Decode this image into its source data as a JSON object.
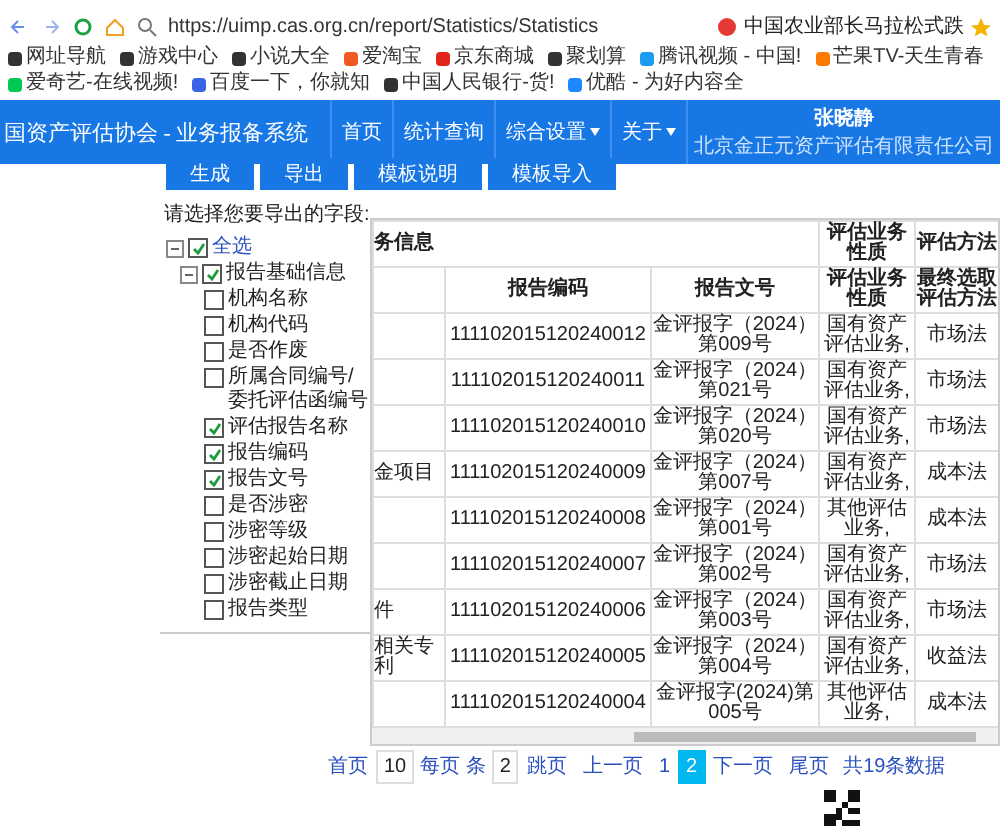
{
  "browser": {
    "url": "https://uimp.cas.org.cn/report/Statistics/Statistics",
    "search_text": "中国农业部长马拉松式跌",
    "bookmarks": [
      "网址导航",
      "游戏中心",
      "小说大全",
      "爱淘宝",
      "京东商城",
      "聚划算",
      "腾讯视频 - 中国!",
      "芒果TV-天生青春",
      "爱奇艺-在线视频!",
      "百度一下，你就知",
      "中国人民银行-货!",
      "优酷 - 为好内容全"
    ]
  },
  "header": {
    "title": "国资产评估协会 - 业务报备系统",
    "nav": [
      {
        "label": "首页",
        "dropdown": false
      },
      {
        "label": "统计查询",
        "dropdown": false
      },
      {
        "label": "综合设置",
        "dropdown": true
      },
      {
        "label": "关于",
        "dropdown": true
      }
    ],
    "user": {
      "name": "张晓静",
      "org": "北京金正元资产评估有限责任公司"
    }
  },
  "toolbar": [
    "生成",
    "导出",
    "模板说明",
    "模板导入"
  ],
  "field_picker": {
    "prompt": "请选择您要导出的字段:",
    "tree": [
      {
        "label": "全选",
        "checked": true,
        "expanded": true,
        "children": [
          {
            "label": "报告基础信息",
            "checked": true,
            "expanded": true,
            "children": [
              {
                "label": "机构名称",
                "checked": false
              },
              {
                "label": "机构代码",
                "checked": false
              },
              {
                "label": "是否作废",
                "checked": false
              },
              {
                "label": "所属合同编号/委托评估函编号",
                "checked": false
              },
              {
                "label": "评估报告名称",
                "checked": true
              },
              {
                "label": "报告编码",
                "checked": true
              },
              {
                "label": "报告文号",
                "checked": true
              },
              {
                "label": "是否涉密",
                "checked": false
              },
              {
                "label": "涉密等级",
                "checked": false
              },
              {
                "label": "涉密起始日期",
                "checked": false
              },
              {
                "label": "涉密截止日期",
                "checked": false
              },
              {
                "label": "报告类型",
                "checked": false
              }
            ]
          }
        ]
      }
    ]
  },
  "table": {
    "group_headers": [
      {
        "label": "务信息"
      },
      {
        "label": "评估业务性质"
      },
      {
        "label": "评估方法"
      }
    ],
    "columns": [
      "报告编码",
      "报告文号",
      "评估业务性质",
      "最终选取评估方法"
    ],
    "rows": [
      {
        "code": "111102015120240012",
        "number": "金评报字（2024）第009号",
        "nature": "国有资产评估业务,",
        "method": "市场法"
      },
      {
        "code": "111102015120240011",
        "number": "金评报字（2024）第021号",
        "nature": "国有资产评估业务,",
        "method": "市场法"
      },
      {
        "code": "111102015120240010",
        "number": "金评报字（2024）第020号",
        "nature": "国有资产评估业务,",
        "method": "市场法"
      },
      {
        "column_1": "金项目",
        "code": "111102015120240009",
        "number": "金评报字（2024）第007号",
        "nature": "国有资产评估业务,",
        "method": "成本法"
      },
      {
        "code": "111102015120240008",
        "number": "金评报字（2024）第001号",
        "nature": "其他评估业务,",
        "method": "成本法"
      },
      {
        "code": "111102015120240007",
        "number": "金评报字（2024）第002号",
        "nature": "国有资产评估业务,",
        "method": "市场法"
      },
      {
        "column_1": "件",
        "code": "111102015120240006",
        "number": "金评报字（2024）第003号",
        "nature": "国有资产评估业务,",
        "method": "市场法"
      },
      {
        "column_1": "相关专利",
        "code": "111102015120240005",
        "number": "金评报字（2024）第004号",
        "nature": "国有资产评估业务,",
        "method": "收益法"
      },
      {
        "code": "111102015120240004",
        "number": "金评报字(2024)第005号",
        "nature": "其他评估业务,",
        "method": "成本法"
      }
    ]
  },
  "pagination": {
    "first": "首页",
    "page_size": "10",
    "page_size_label": "每页 条",
    "jump_page": "2",
    "jump_label": "跳页",
    "prev": "上一页",
    "pages": [
      {
        "label": "1",
        "selected": false
      },
      {
        "label": "2",
        "selected": true
      }
    ],
    "next": "下一页",
    "last": "尾页",
    "total": "共19条数据"
  }
}
